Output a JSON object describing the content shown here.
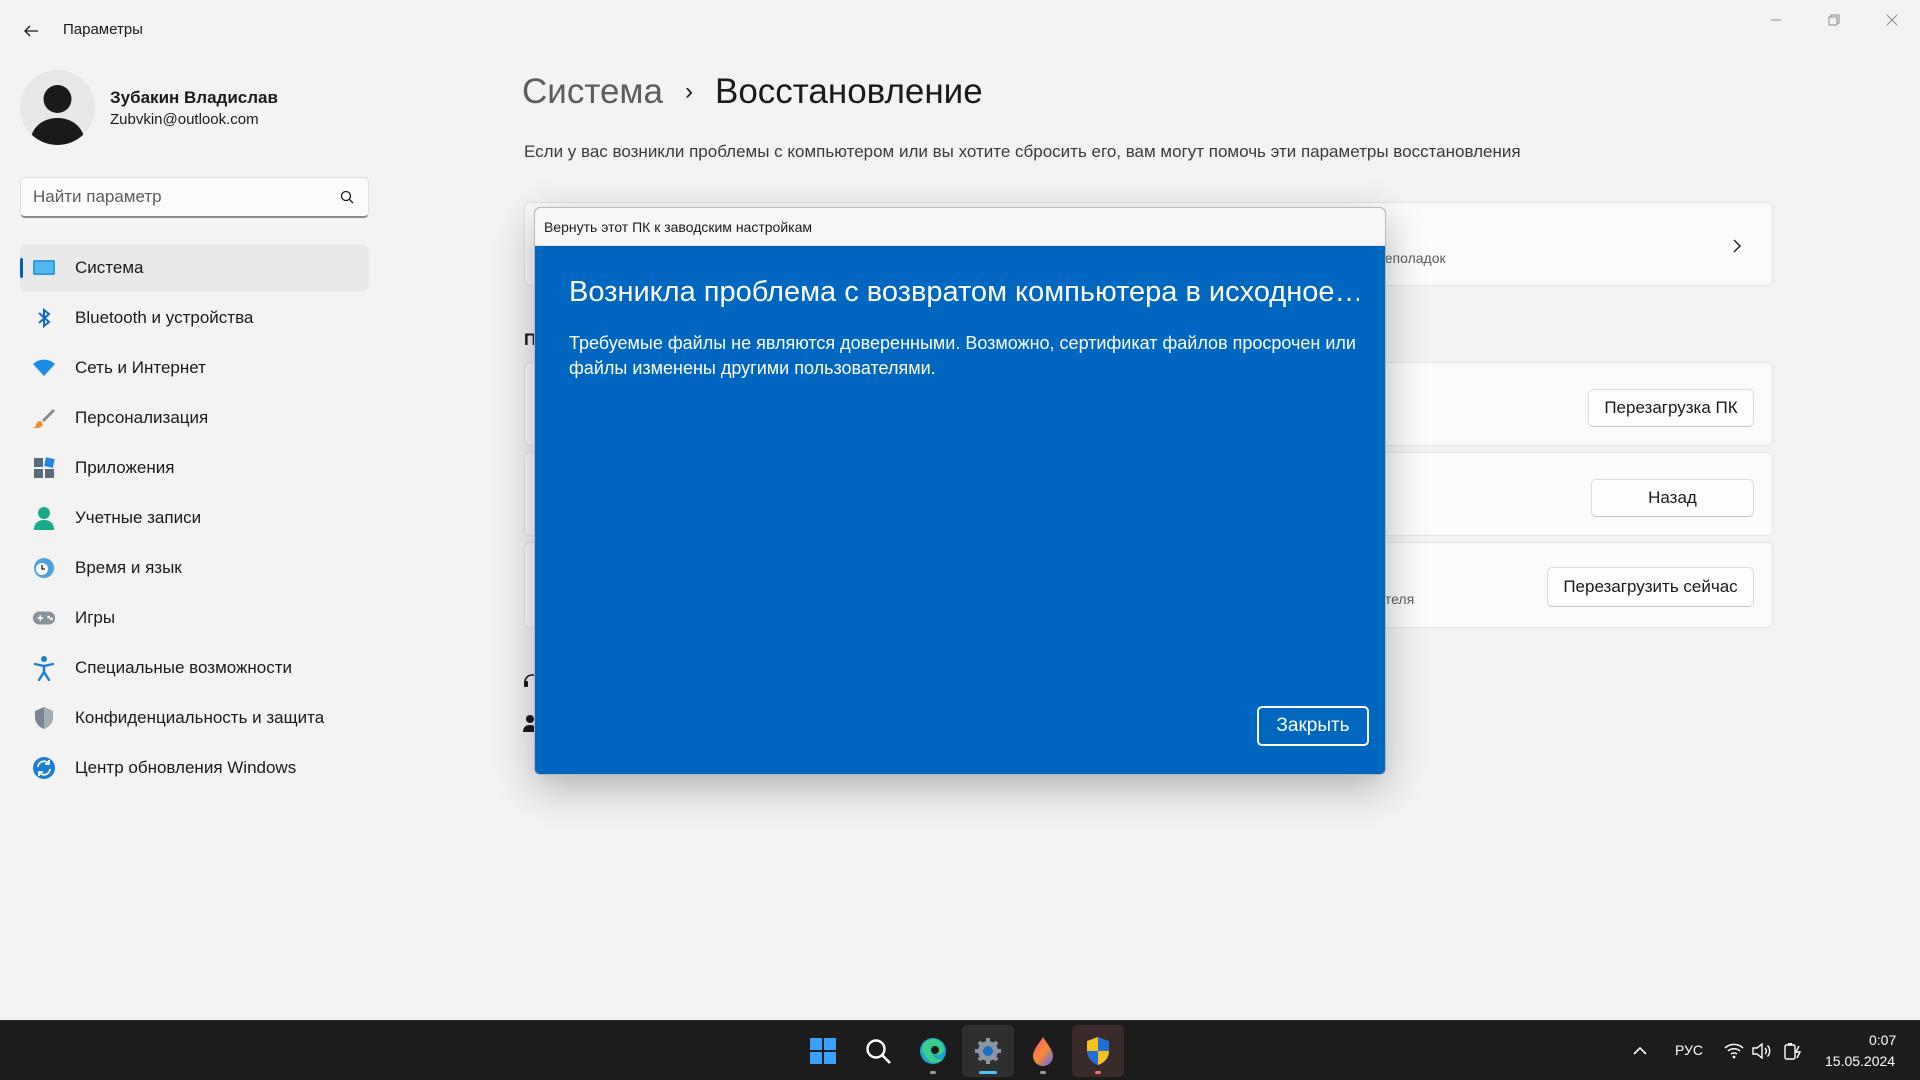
{
  "window": {
    "title": "Параметры"
  },
  "profile": {
    "name": "Зубакин Владислав",
    "email": "Zubvkin@outlook.com"
  },
  "search": {
    "placeholder": "Найти параметр"
  },
  "sidebar": {
    "items": [
      {
        "label": "Система",
        "icon": "system-icon",
        "active": true
      },
      {
        "label": "Bluetooth и устройства",
        "icon": "bluetooth-icon"
      },
      {
        "label": "Сеть и Интернет",
        "icon": "wifi-icon"
      },
      {
        "label": "Персонализация",
        "icon": "brush-icon"
      },
      {
        "label": "Приложения",
        "icon": "apps-icon"
      },
      {
        "label": "Учетные записи",
        "icon": "account-icon"
      },
      {
        "label": "Время и язык",
        "icon": "clock-globe-icon"
      },
      {
        "label": "Игры",
        "icon": "gamepad-icon"
      },
      {
        "label": "Специальные возможности",
        "icon": "accessibility-icon"
      },
      {
        "label": "Конфиденциальность и защита",
        "icon": "shield-icon"
      },
      {
        "label": "Центр обновления Windows",
        "icon": "update-icon"
      }
    ]
  },
  "breadcrumb": {
    "parent": "Система",
    "separator": "›",
    "current": "Восстановление"
  },
  "page": {
    "description": "Если у вас возникли проблемы с компьютером или вы хотите сбросить его, вам могут помочь эти параметры восстановления",
    "card1_sub_visible": "неполадок",
    "section_label_visible": "П",
    "card4_sub_visible": "ителя",
    "buttons": {
      "reset": "Перезагрузка ПК",
      "back": "Назад",
      "restart": "Перезагрузить сейчас"
    }
  },
  "dialog": {
    "title": "Вернуть этот ПК к заводским настройкам",
    "heading": "Возникла проблема с возвратом компьютера в исходное…",
    "message": "Требуемые файлы не являются доверенными. Возможно, сертификат файлов просрочен или файлы изменены другими пользователями.",
    "close_label": "Закрыть",
    "background_color": "#0067c0"
  },
  "taskbar": {
    "apps": [
      {
        "name": "start-icon"
      },
      {
        "name": "search-icon"
      },
      {
        "name": "edge-icon"
      },
      {
        "name": "settings-icon",
        "active": true
      },
      {
        "name": "paint-drop-icon"
      },
      {
        "name": "defender-shield-icon"
      }
    ],
    "tray": {
      "language": "РУС",
      "time": "0:07",
      "date": "15.05.2024"
    }
  },
  "colors": {
    "accent": "#005fb8",
    "dialog_blue": "#0067c0",
    "taskbar": "#1c1c1c"
  }
}
